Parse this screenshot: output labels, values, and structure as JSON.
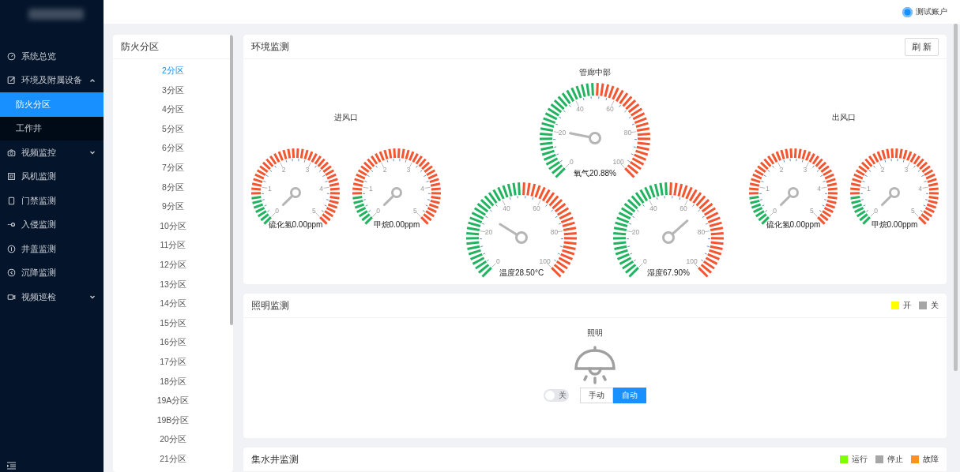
{
  "header": {
    "user": "测试账户"
  },
  "sidebar": {
    "items": [
      {
        "label": "系统总览",
        "selected": false
      },
      {
        "label": "环境及附属设备",
        "selected": false,
        "expanded": true,
        "children": [
          {
            "label": "防火分区",
            "selected": true
          },
          {
            "label": "工作井",
            "selected": false
          }
        ]
      },
      {
        "label": "视频监控",
        "selected": false,
        "expanded": false
      },
      {
        "label": "风机监测",
        "selected": false
      },
      {
        "label": "门禁监测",
        "selected": false
      },
      {
        "label": "入侵监测",
        "selected": false
      },
      {
        "label": "井盖监测",
        "selected": false
      },
      {
        "label": "沉降监测",
        "selected": false
      },
      {
        "label": "视频巡检",
        "selected": false,
        "expanded": false
      }
    ]
  },
  "zones": {
    "title": "防火分区",
    "items": [
      {
        "label": "2分区",
        "selected": true
      },
      {
        "label": "3分区",
        "selected": false
      },
      {
        "label": "4分区",
        "selected": false
      },
      {
        "label": "5分区",
        "selected": false
      },
      {
        "label": "6分区",
        "selected": false
      },
      {
        "label": "7分区",
        "selected": false
      },
      {
        "label": "8分区",
        "selected": false
      },
      {
        "label": "9分区",
        "selected": false
      },
      {
        "label": "10分区",
        "selected": false
      },
      {
        "label": "11分区",
        "selected": false
      },
      {
        "label": "12分区",
        "selected": false
      },
      {
        "label": "13分区",
        "selected": false
      },
      {
        "label": "14分区",
        "selected": false
      },
      {
        "label": "15分区",
        "selected": false
      },
      {
        "label": "16分区",
        "selected": false
      },
      {
        "label": "17分区",
        "selected": false
      },
      {
        "label": "18分区",
        "selected": false
      },
      {
        "label": "19A分区",
        "selected": false
      },
      {
        "label": "19B分区",
        "selected": false
      },
      {
        "label": "20分区",
        "selected": false
      },
      {
        "label": "21分区",
        "selected": false
      }
    ]
  },
  "environment": {
    "title": "环境监测",
    "refresh": "刷 新",
    "groups": [
      {
        "title": "进风口",
        "gauges": [
          {
            "kind": "small",
            "label": "硫化氢0.00ppm",
            "ticks": [
              "0",
              "1",
              "2",
              "3",
              "4",
              "5"
            ]
          },
          {
            "kind": "small",
            "label": "甲烷0.00ppm",
            "ticks": [
              "0",
              "1",
              "2",
              "3",
              "4",
              "5"
            ]
          }
        ]
      },
      {
        "title": "管廊中部",
        "gauges": [
          {
            "kind": "large",
            "label": "氧气20.88%",
            "ticks": [
              "0",
              "20",
              "40",
              "60",
              "80",
              "100"
            ]
          },
          {
            "kind": "large",
            "label": "温度28.50°C",
            "ticks": [
              "0",
              "20",
              "40",
              "60",
              "80",
              "100"
            ]
          },
          {
            "kind": "large",
            "label": "湿度67.90%",
            "ticks": [
              "0",
              "20",
              "40",
              "60",
              "80",
              "100"
            ]
          }
        ]
      },
      {
        "title": "出风口",
        "gauges": [
          {
            "kind": "small",
            "label": "硫化氢0.00ppm",
            "ticks": [
              "0",
              "1",
              "2",
              "3",
              "4",
              "5"
            ]
          },
          {
            "kind": "small",
            "label": "甲烷0.00ppm",
            "ticks": [
              "0",
              "1",
              "2",
              "3",
              "4",
              "5"
            ]
          }
        ]
      }
    ]
  },
  "lighting": {
    "title": "照明监测",
    "legend": [
      {
        "label": "开",
        "color": "#ffff00"
      },
      {
        "label": "关",
        "color": "#a6a6a6"
      }
    ],
    "device": {
      "title": "照明",
      "on": false,
      "switch": {
        "on": false,
        "text": "关"
      },
      "modes": [
        {
          "label": "手动",
          "selected": false
        },
        {
          "label": "自动",
          "selected": true
        }
      ]
    }
  },
  "sump": {
    "title": "集水井监测",
    "legend": [
      {
        "label": "运行",
        "color": "#7fff00"
      },
      {
        "label": "停止",
        "color": "#a6a6a6"
      },
      {
        "label": "故障",
        "color": "#f7931e"
      }
    ]
  }
}
